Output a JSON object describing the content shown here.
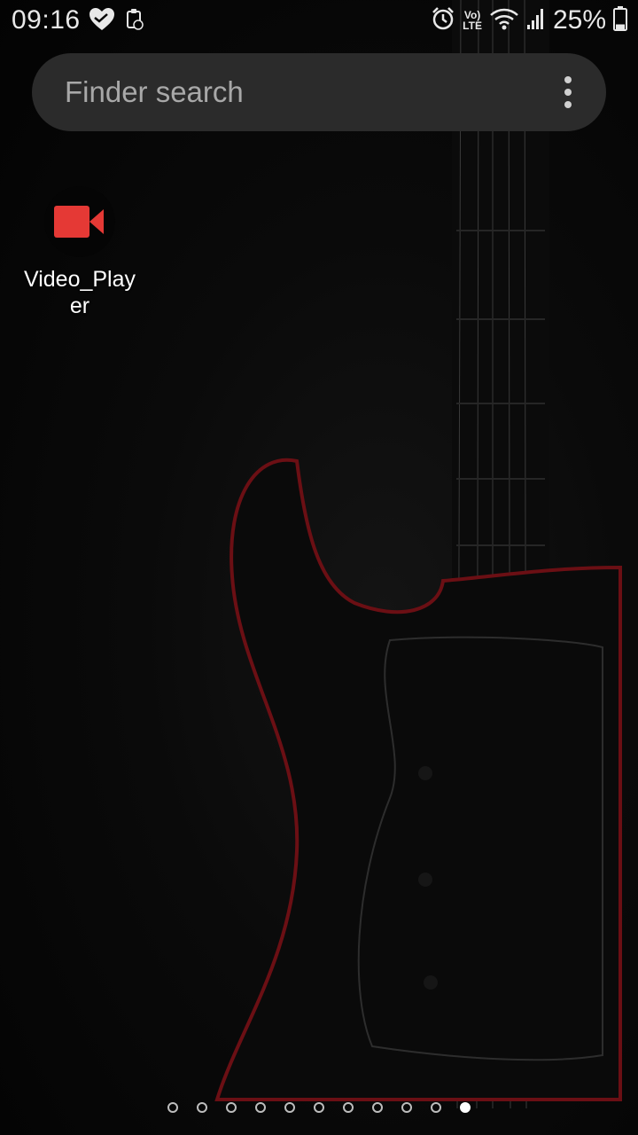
{
  "status_bar": {
    "time": "09:16",
    "network_label": "LTE",
    "volte_label": "Vo)",
    "battery_percent": "25%",
    "battery_level": 0.25,
    "icons": [
      "heart-icon",
      "clipboard-icon",
      "alarm-icon",
      "volte-lte-icon",
      "wifi-icon",
      "signal-icon",
      "battery-icon"
    ]
  },
  "search": {
    "placeholder": "Finder search",
    "menu_icon": "more-vertical-icon"
  },
  "apps": [
    {
      "label": "Video_Player",
      "icon": "video-camera-icon",
      "icon_color": "#e53935"
    }
  ],
  "page_indicator": {
    "total": 11,
    "active_index": 10
  },
  "colors": {
    "accent": "#e53935",
    "search_bg": "#2b2b2b",
    "background": "#050505"
  }
}
